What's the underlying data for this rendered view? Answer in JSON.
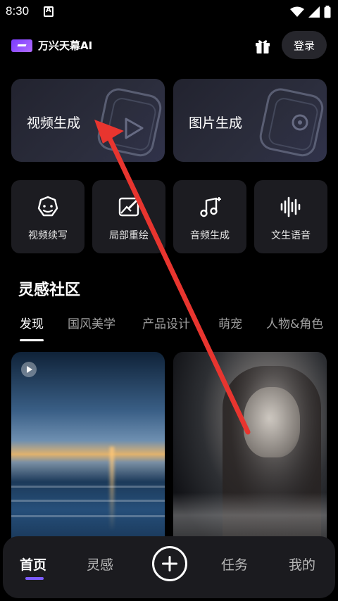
{
  "status_bar": {
    "time": "8:30",
    "icons": [
      "notification-a-icon",
      "wifi-icon",
      "signal-icon",
      "battery-icon"
    ]
  },
  "header": {
    "brand": "万兴天幕AI",
    "login_label": "登录",
    "icons": [
      "logo-icon",
      "gift-icon"
    ]
  },
  "big_cards": [
    {
      "label": "视频生成",
      "icon": "video-frame-icon"
    },
    {
      "label": "图片生成",
      "icon": "image-frame-icon"
    }
  ],
  "tools": [
    {
      "label": "视频续写",
      "icon": "video-extend-icon"
    },
    {
      "label": "局部重绘",
      "icon": "inpaint-icon"
    },
    {
      "label": "音频生成",
      "icon": "music-note-icon"
    },
    {
      "label": "文生语音",
      "icon": "waveform-icon"
    }
  ],
  "community": {
    "title": "灵感社区",
    "tabs": [
      "发现",
      "国风美学",
      "产品设计",
      "萌宠",
      "人物&角色"
    ],
    "active_tab": "发现"
  },
  "feed": [
    {
      "type": "video",
      "scene": "ocean-sunset",
      "icon": "play-icon"
    },
    {
      "type": "image",
      "scene": "woman-portrait-double-exposure"
    }
  ],
  "bottom_nav": {
    "items": [
      "首页",
      "灵感",
      "任务",
      "我的"
    ],
    "active": "首页",
    "add_icon": "plus-circle-icon"
  },
  "colors": {
    "accent": "#7d5cff",
    "arrow": "#e8352f",
    "background": "#000000",
    "card": "#1c1c21"
  }
}
